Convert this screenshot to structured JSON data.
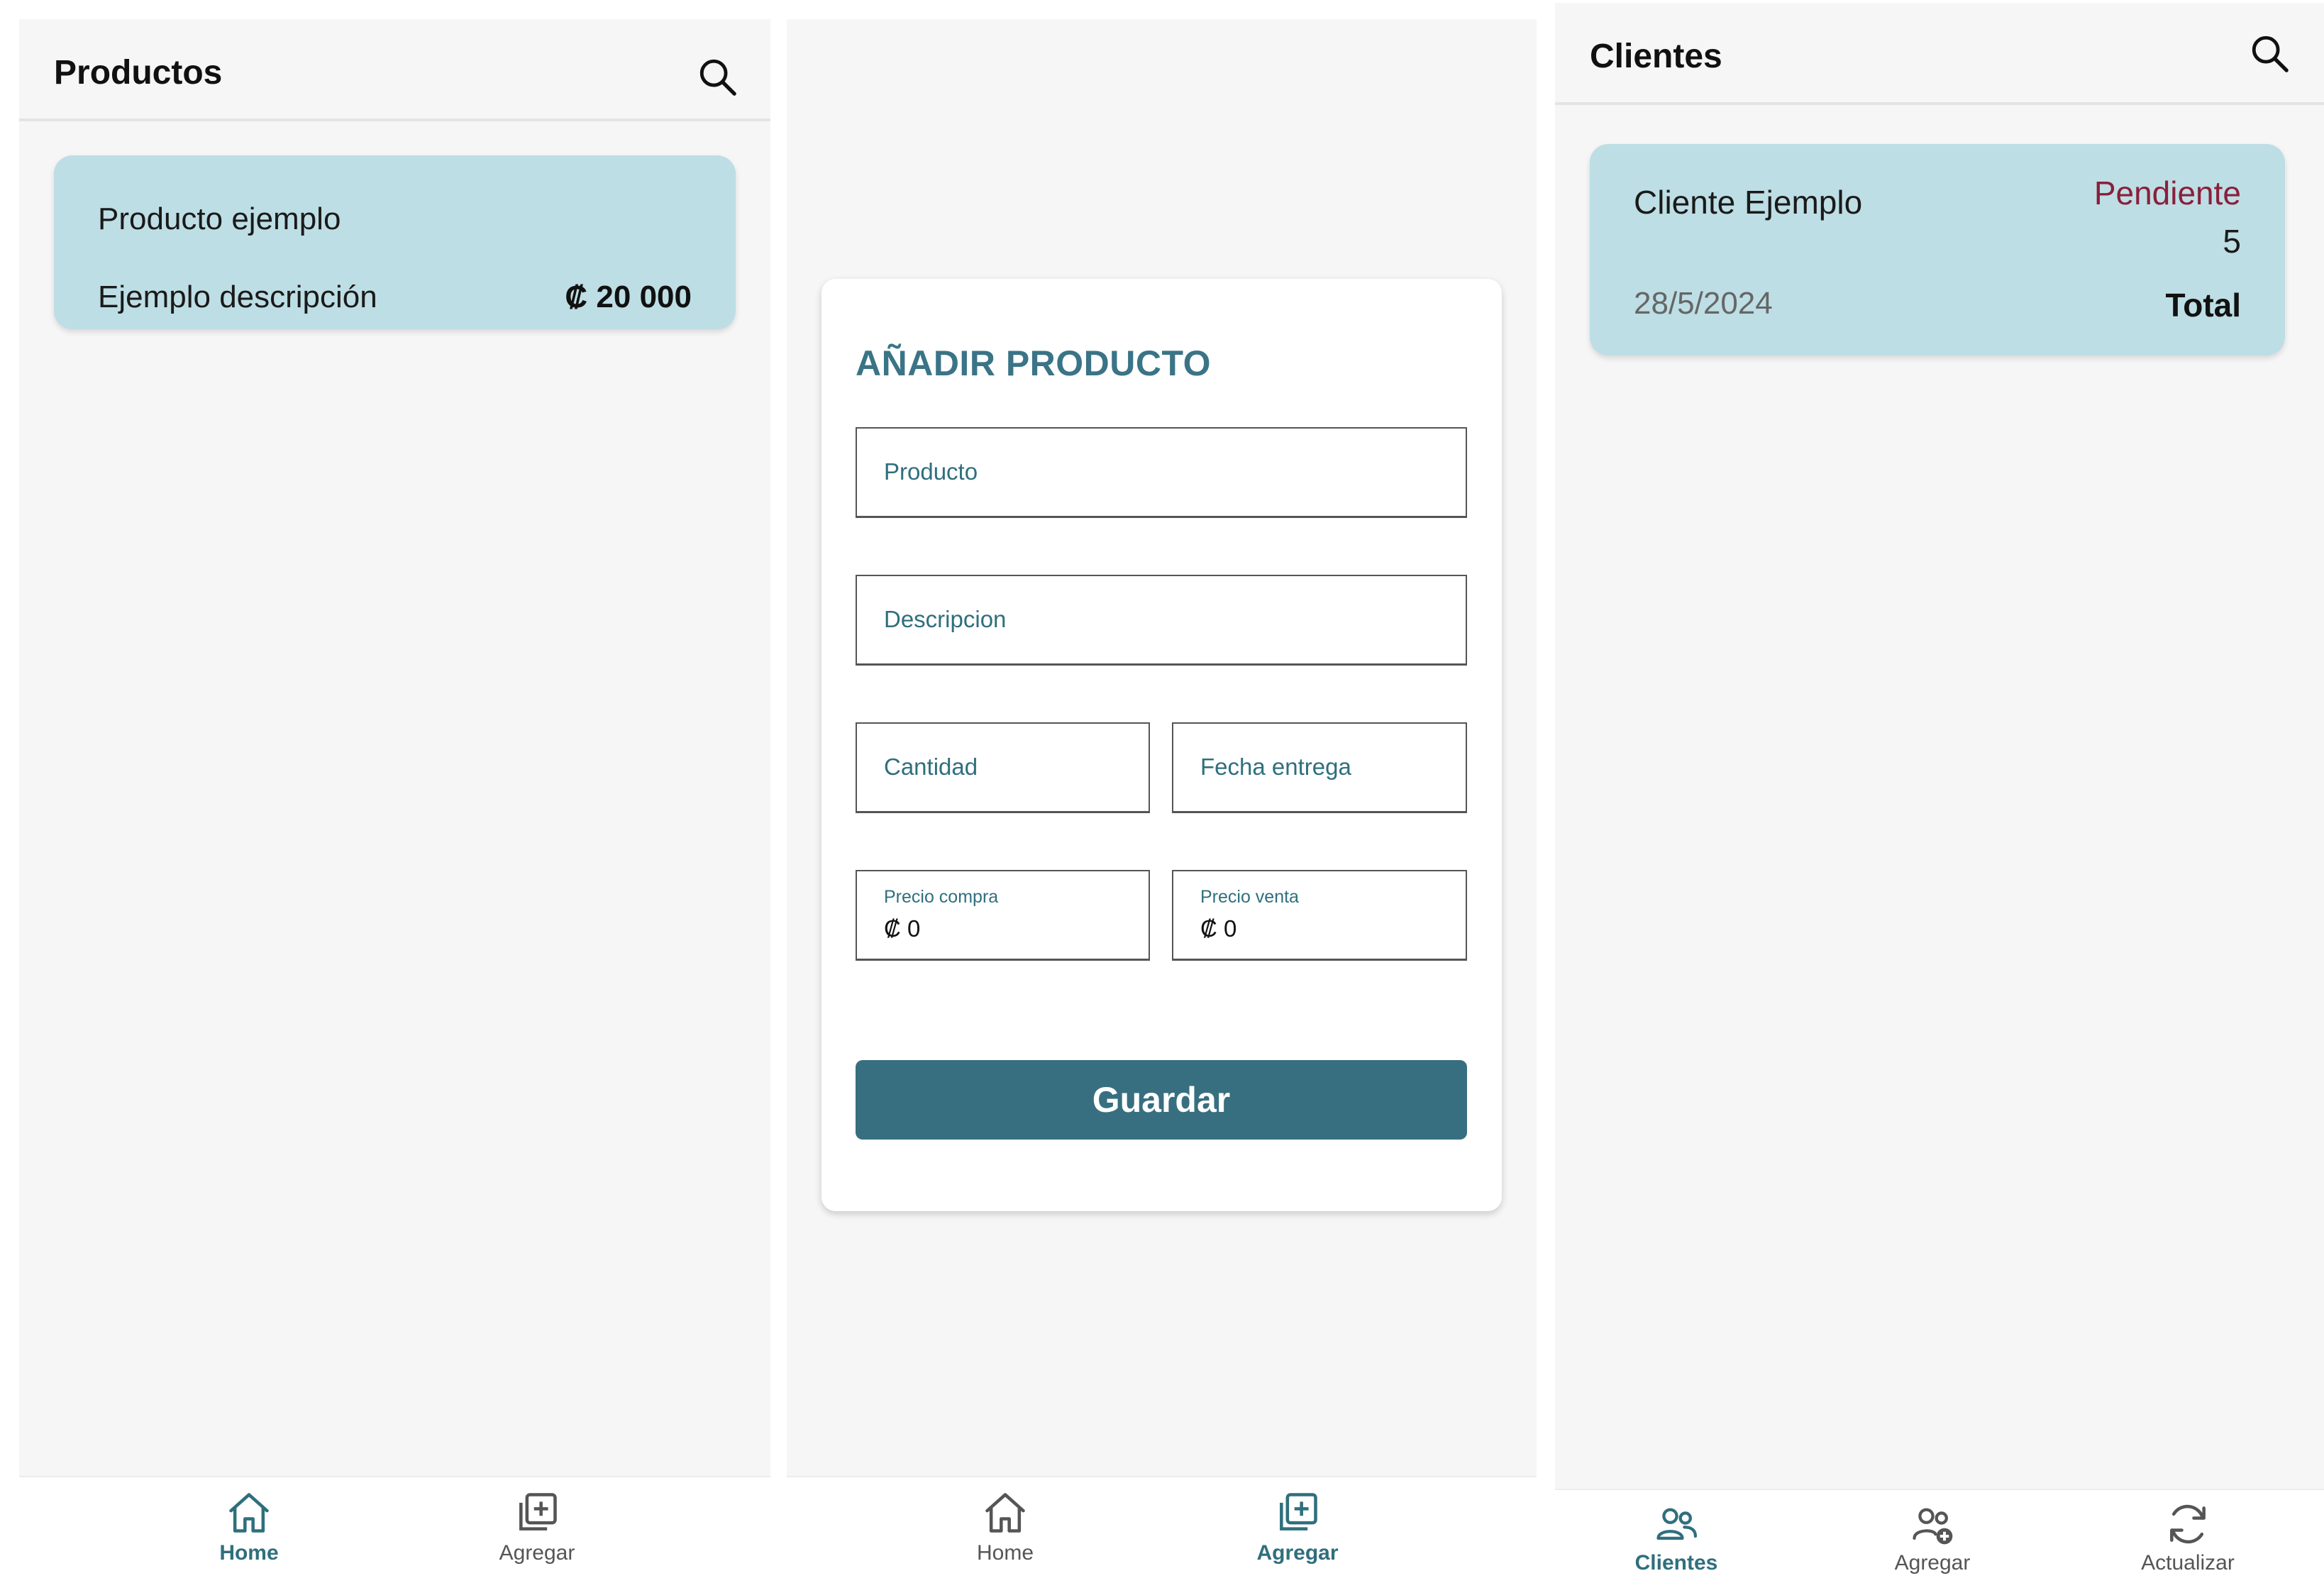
{
  "colors": {
    "accent": "#386f80",
    "card": "#bddee4",
    "status_pending": "#8a1f3a"
  },
  "productos": {
    "title": "Productos",
    "card": {
      "name": "Producto ejemplo",
      "description": "Ejemplo descripción",
      "price": "₡ 20 000"
    },
    "nav": [
      {
        "label": "Home",
        "icon": "home-icon",
        "active": true
      },
      {
        "label": "Agregar",
        "icon": "add-box-icon",
        "active": false
      }
    ]
  },
  "form": {
    "title": "AÑADIR PRODUCTO",
    "producto_placeholder": "Producto",
    "descripcion_placeholder": "Descripcion",
    "cantidad_placeholder": "Cantidad",
    "fecha_placeholder": "Fecha entrega",
    "precio_compra_label": "Precio compra",
    "precio_compra_value": "₡ 0",
    "precio_venta_label": "Precio venta",
    "precio_venta_value": "₡ 0",
    "save_label": "Guardar",
    "nav": [
      {
        "label": "Home",
        "icon": "home-icon",
        "active": false
      },
      {
        "label": "Agregar",
        "icon": "add-box-icon",
        "active": true
      }
    ]
  },
  "clientes": {
    "title": "Clientes",
    "card": {
      "name": "Cliente Ejemplo",
      "status": "Pendiente",
      "count": "5",
      "date": "28/5/2024",
      "total_label": "Total"
    },
    "nav": [
      {
        "label": "Clientes",
        "icon": "people-icon",
        "active": true
      },
      {
        "label": "Agregar",
        "icon": "add-person-icon",
        "active": false
      },
      {
        "label": "Actualizar",
        "icon": "refresh-icon",
        "active": false
      }
    ]
  }
}
